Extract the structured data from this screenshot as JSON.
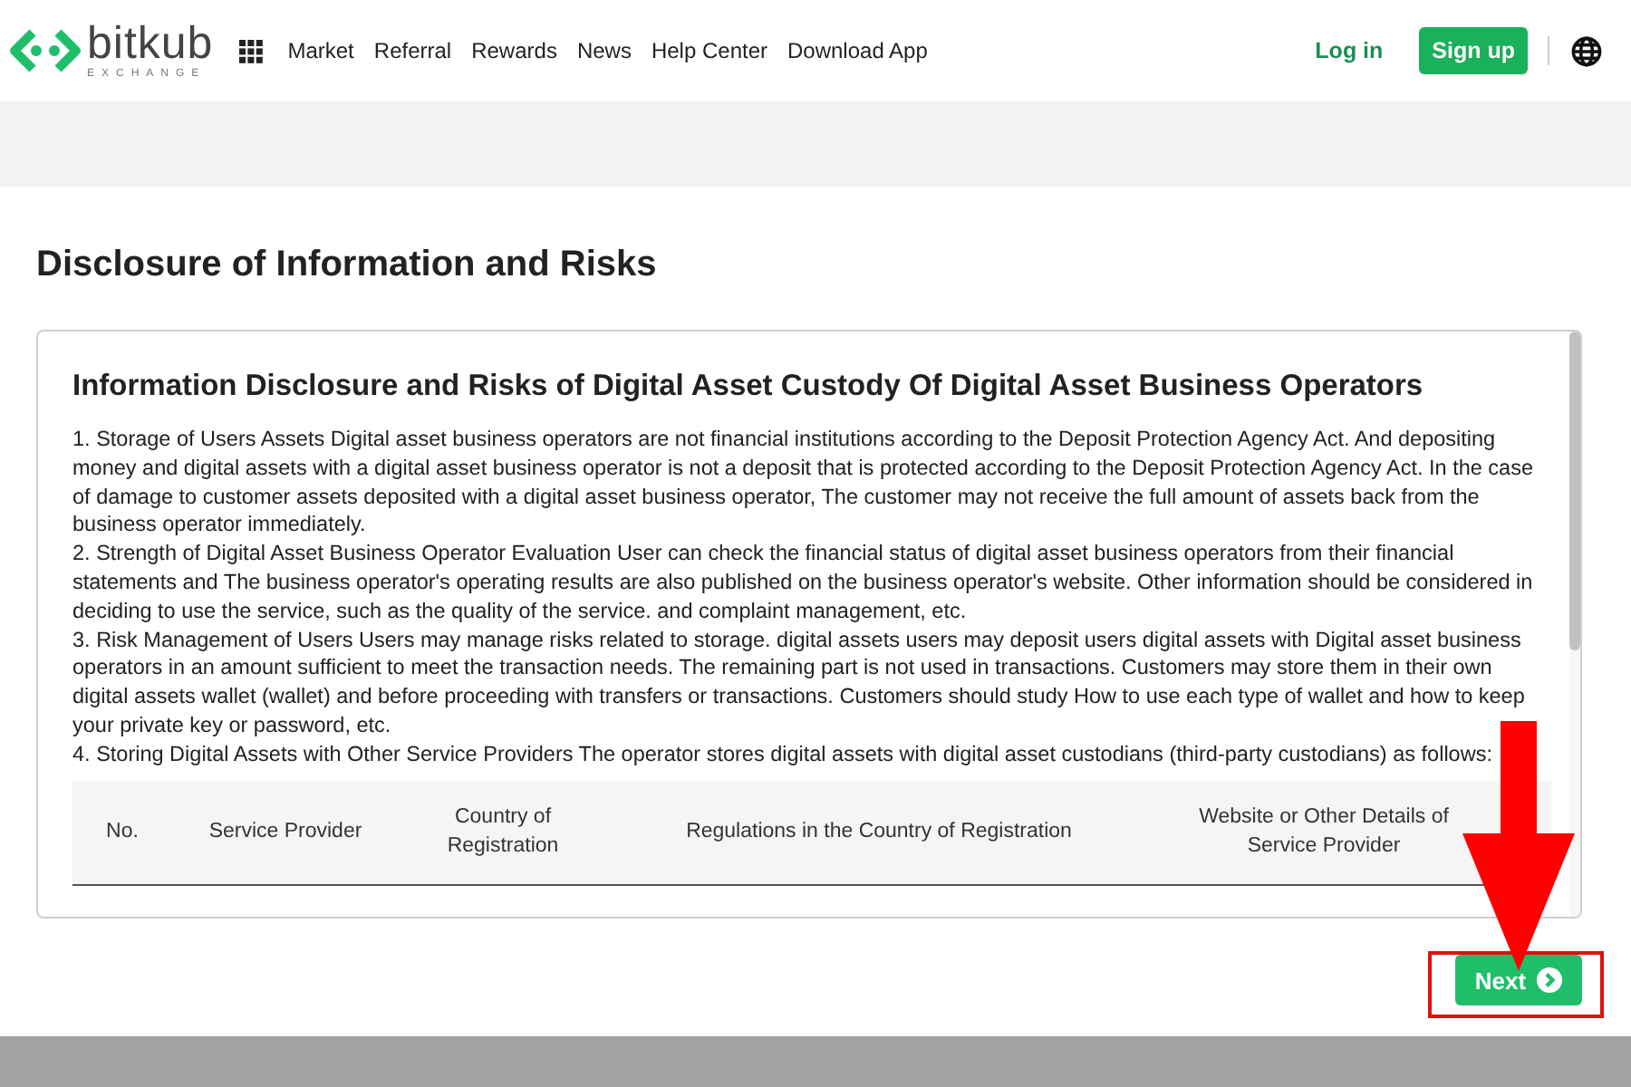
{
  "header": {
    "logo": {
      "name": "bitkub",
      "tagline": "EXCHANGE"
    },
    "nav": [
      "Market",
      "Referral",
      "Rewards",
      "News",
      "Help Center",
      "Download App"
    ],
    "login": "Log in",
    "signup": "Sign up"
  },
  "page_title": "Disclosure of Information and Risks",
  "document": {
    "heading": "Information Disclosure and Risks of Digital Asset Custody Of Digital Asset Business Operators",
    "paragraphs": [
      "1. Storage of Users Assets Digital asset business operators are not financial institutions according to the Deposit Protection Agency Act. And depositing money and digital assets with a digital asset business operator is not a deposit that is protected according to the Deposit Protection Agency Act. In the case of damage to customer assets deposited with a digital asset business operator, The customer may not receive the full amount of assets back from the business operator immediately.",
      "2. Strength of Digital Asset Business Operator Evaluation User can check the financial status of digital asset business operators from their financial statements and The business operator's operating results are also published on the business operator's website. Other information should be considered in deciding to use the service, such as the quality of the service. and complaint management, etc.",
      "3. Risk Management of Users Users may manage risks related to storage. digital assets users may deposit users digital assets with Digital asset business operators in an amount sufficient to meet the transaction needs. The remaining part is not used in transactions. Customers may store them in their own digital assets wallet (wallet) and before proceeding with transfers or transactions. Customers should study How to use each type of wallet and how to keep your private key or password, etc.",
      "4. Storing Digital Assets with Other Service Providers The operator stores digital assets with digital asset custodians (third-party custodians) as follows:"
    ],
    "table": {
      "columns": [
        "No.",
        "Service Provider",
        "Country of Registration",
        "Regulations in the Country of Registration",
        "Website or Other Details of Service Provider"
      ]
    }
  },
  "next_button": "Next"
}
